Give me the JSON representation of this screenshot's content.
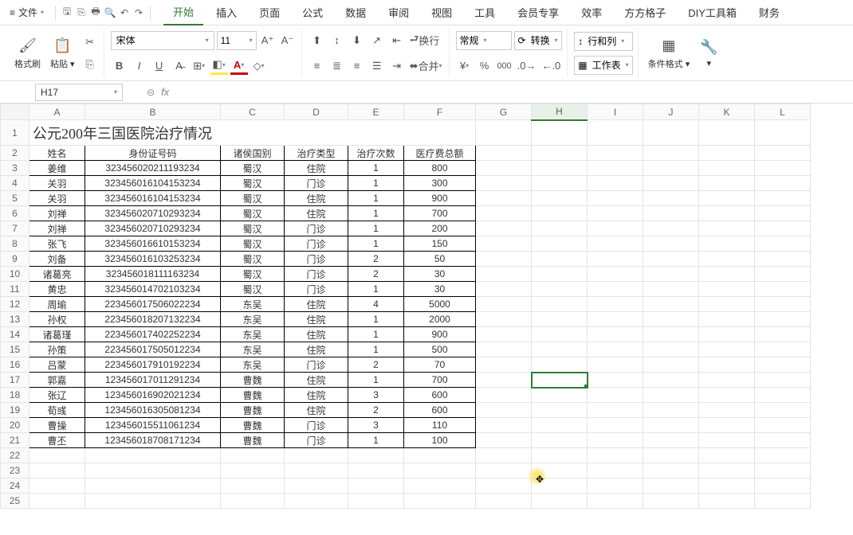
{
  "menubar": {
    "file_label": "文件",
    "icons": [
      "save-icon",
      "export-icon",
      "print-icon",
      "preview-icon",
      "undo-icon",
      "redo-icon"
    ]
  },
  "tabs": [
    "开始",
    "插入",
    "页面",
    "公式",
    "数据",
    "审阅",
    "视图",
    "工具",
    "会员专享",
    "效率",
    "方方格子",
    "DIY工具箱",
    "财务"
  ],
  "active_tab": 0,
  "ribbon": {
    "format_painter": "格式刷",
    "paste": "粘贴",
    "font_name": "宋体",
    "font_size": "11",
    "wrap_label": "换行",
    "merge_label": "合并",
    "number_format": "常规",
    "convert": "转换",
    "rowcol": "行和列",
    "worksheet": "工作表",
    "cond_format": "条件格式"
  },
  "formula_bar": {
    "cell_ref": "H17",
    "formula": ""
  },
  "columns": [
    "A",
    "B",
    "C",
    "D",
    "E",
    "F",
    "G",
    "H",
    "I",
    "J",
    "K",
    "L"
  ],
  "title": "公元200年三国医院治疗情况",
  "headers": [
    "姓名",
    "身份证号码",
    "诸侯国别",
    "治疗类型",
    "治疗次数",
    "医疗费总额"
  ],
  "chart_data": {
    "type": "table",
    "columns": [
      "姓名",
      "身份证号码",
      "诸侯国别",
      "治疗类型",
      "治疗次数",
      "医疗费总额"
    ],
    "rows": [
      [
        "姜维",
        "323456020211193234",
        "蜀汉",
        "住院",
        "1",
        "800"
      ],
      [
        "关羽",
        "323456016104153234",
        "蜀汉",
        "门诊",
        "1",
        "300"
      ],
      [
        "关羽",
        "323456016104153234",
        "蜀汉",
        "住院",
        "1",
        "900"
      ],
      [
        "刘禅",
        "323456020710293234",
        "蜀汉",
        "住院",
        "1",
        "700"
      ],
      [
        "刘禅",
        "323456020710293234",
        "蜀汉",
        "门诊",
        "1",
        "200"
      ],
      [
        "张飞",
        "323456016610153234",
        "蜀汉",
        "门诊",
        "1",
        "150"
      ],
      [
        "刘备",
        "323456016103253234",
        "蜀汉",
        "门诊",
        "2",
        "50"
      ],
      [
        "诸葛亮",
        "323456018111163234",
        "蜀汉",
        "门诊",
        "2",
        "30"
      ],
      [
        "黄忠",
        "323456014702103234",
        "蜀汉",
        "门诊",
        "1",
        "30"
      ],
      [
        "周瑜",
        "223456017506022234",
        "东吴",
        "住院",
        "4",
        "5000"
      ],
      [
        "孙权",
        "223456018207132234",
        "东吴",
        "住院",
        "1",
        "2000"
      ],
      [
        "诸葛瑾",
        "223456017402252234",
        "东吴",
        "住院",
        "1",
        "900"
      ],
      [
        "孙策",
        "223456017505012234",
        "东吴",
        "住院",
        "1",
        "500"
      ],
      [
        "吕蒙",
        "223456017910192234",
        "东吴",
        "门诊",
        "2",
        "70"
      ],
      [
        "郭嘉",
        "123456017011291234",
        "曹魏",
        "住院",
        "1",
        "700"
      ],
      [
        "张辽",
        "123456016902021234",
        "曹魏",
        "住院",
        "3",
        "600"
      ],
      [
        "荀彧",
        "123456016305081234",
        "曹魏",
        "住院",
        "2",
        "600"
      ],
      [
        "曹操",
        "123456015511061234",
        "曹魏",
        "门诊",
        "3",
        "110"
      ],
      [
        "曹丕",
        "123456018708171234",
        "曹魏",
        "门诊",
        "1",
        "100"
      ]
    ]
  },
  "selected_cell": "H17"
}
